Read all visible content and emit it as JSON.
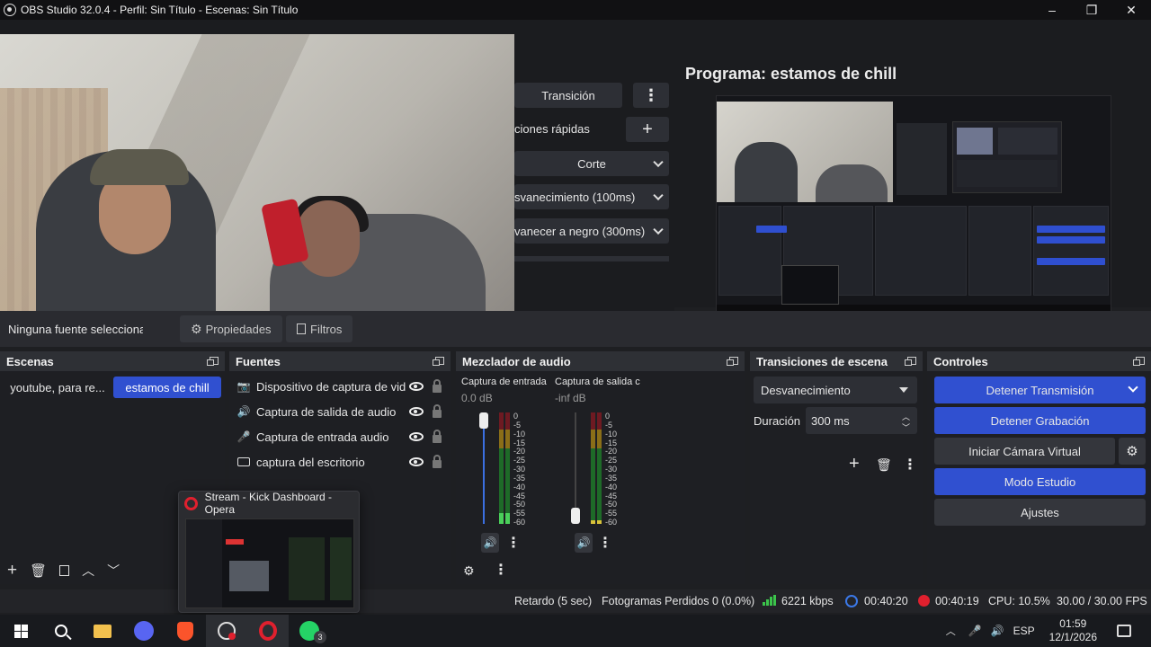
{
  "window": {
    "title": "OBS Studio 32.0.4 - Perfil: Sin Título - Escenas: Sin Título",
    "minimize": "–",
    "restore": "❐",
    "close": "✕"
  },
  "transition_panel": {
    "transition_label": "Transición",
    "quick_transitions_label": "ciones rápidas",
    "items": [
      "Corte",
      "svanecimiento (100ms)",
      "vanecer a negro (300ms)"
    ]
  },
  "program": {
    "label": "Programa: estamos de chill"
  },
  "source_bar": {
    "no_selection": "Ninguna fuente seleccionada",
    "properties": "Propiedades",
    "filters": "Filtros"
  },
  "scenes": {
    "title": "Escenas",
    "items": [
      {
        "label": "youtube, para re...",
        "active": false
      },
      {
        "label": "estamos de chill",
        "active": true
      }
    ]
  },
  "sources": {
    "title": "Fuentes",
    "items": [
      {
        "label": "Dispositivo de captura de vid",
        "icon": "camera-icon"
      },
      {
        "label": "Captura de salida de audio",
        "icon": "speaker-icon"
      },
      {
        "label": "Captura de entrada audio",
        "icon": "microphone-icon"
      },
      {
        "label": "captura del escritorio",
        "icon": "monitor-icon"
      }
    ]
  },
  "mixer": {
    "title": "Mezclador de audio",
    "channels": [
      {
        "name": "Captura de entrada",
        "db": "0.0 dB",
        "level": 0.1,
        "fader": 1.0
      },
      {
        "name": "Captura de salida c",
        "db": "-inf dB",
        "level": 0.0,
        "fader": 0.0
      }
    ],
    "scale": [
      "0",
      "-5",
      "-10",
      "-15",
      "-20",
      "-25",
      "-30",
      "-35",
      "-40",
      "-45",
      "-50",
      "-55",
      "-60"
    ]
  },
  "scene_transitions": {
    "title": "Transiciones de escena",
    "selected": "Desvanecimiento",
    "duration_label": "Duración",
    "duration_value": "300 ms"
  },
  "controls": {
    "title": "Controles",
    "stop_stream": "Detener Transmisión",
    "stop_recording": "Detener Grabación",
    "virtual_cam": "Iniciar Cámara Virtual",
    "studio_mode": "Modo Estudio",
    "settings": "Ajustes",
    "accent": "#3050d0"
  },
  "status": {
    "delay": "Retardo (5 sec)",
    "dropped": "Fotogramas Perdidos 0 (0.0%)",
    "kbps": "6221 kbps",
    "stream_time": "00:40:20",
    "rec_time": "00:40:19",
    "cpu": "CPU: 10.5%",
    "fps": "30.00 / 30.00 FPS"
  },
  "popup": {
    "title": "Stream - Kick Dashboard - Opera"
  },
  "taskbar": {
    "lang": "ESP",
    "time": "01:59",
    "date": "12/1/2026",
    "whatsapp_badge": "3"
  }
}
